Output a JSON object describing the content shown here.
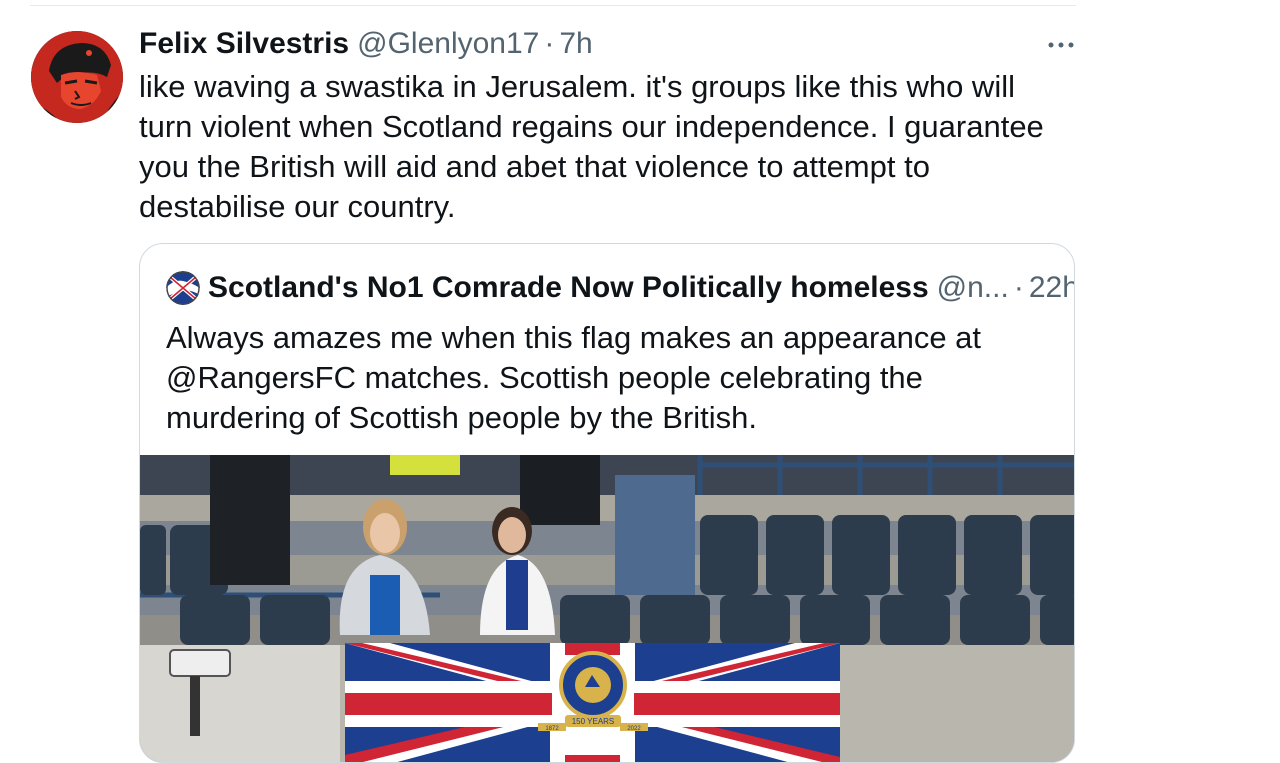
{
  "tweet": {
    "author_name": "Felix Silvestris",
    "handle": "@Glenlyon17",
    "separator": "·",
    "time": "7h",
    "text": "like waving a swastika in Jerusalem. it's groups like this who will turn violent when Scotland regains our independence. I guarantee you the British will aid and abet that violence to attempt to destabilise our country.",
    "avatar_icon": "che-portrait-avatar",
    "more_icon": "more-options-icon"
  },
  "quoted_tweet": {
    "author_name": "Scotland's No1 Comrade Now Politically homeless",
    "handle": "@n...",
    "separator": "·",
    "time": "22h",
    "text": "Always amazes me when this flag makes an appearance at @RangersFC matches. Scottish people celebrating the murdering of Scottish people by the British.",
    "avatar_icon": "flag-avatar",
    "media": {
      "description_icon": "stadium-photo",
      "badge_text": "150 YEARS",
      "badge_left": "1872",
      "badge_right": "2022",
      "badge_ring": "RANGERS FOOTBALL CLUB"
    }
  },
  "colors": {
    "text_primary": "#0f1419",
    "text_secondary": "#536471",
    "border": "#cfd9de",
    "flag_blue": "#1d3f8f",
    "flag_red": "#cf2534"
  }
}
